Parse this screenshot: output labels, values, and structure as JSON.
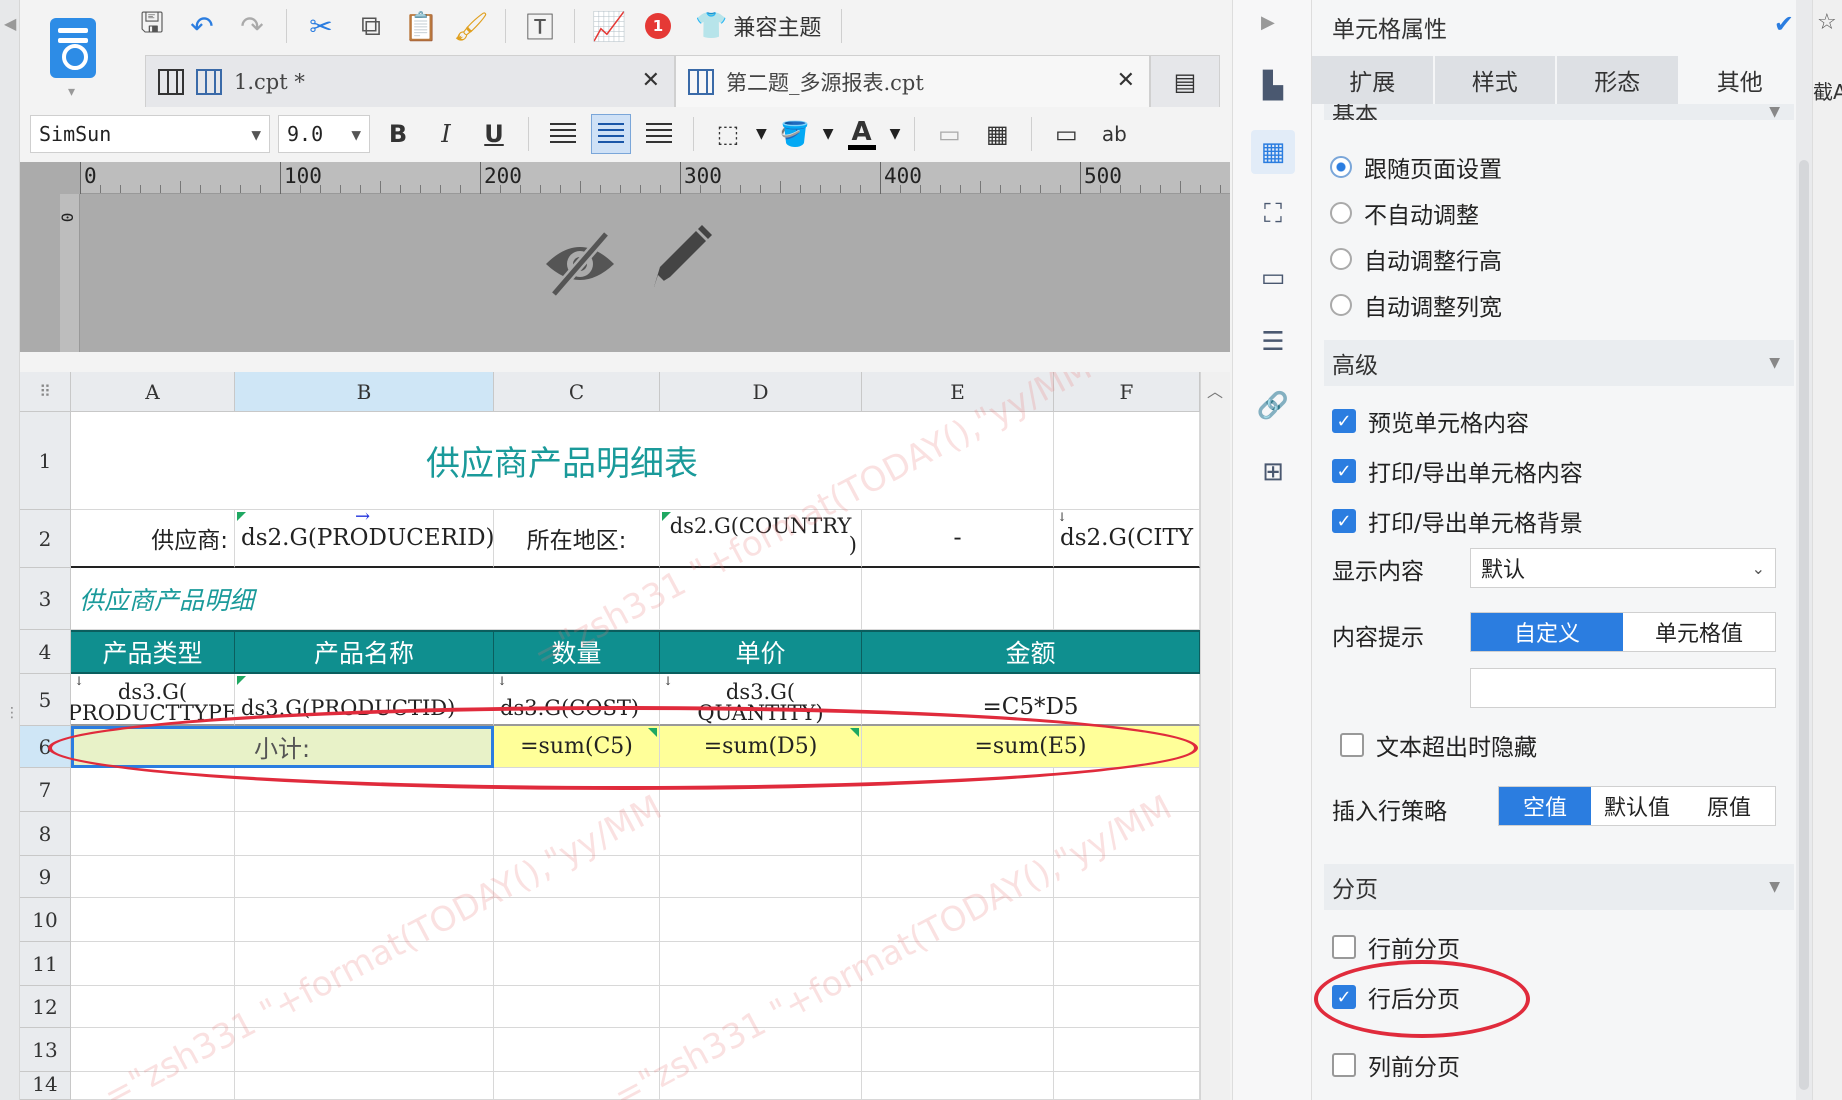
{
  "toolbar": {
    "compat_theme": "兼容主题",
    "notification_count": "1",
    "font_name": "SimSun",
    "font_size": "9.0",
    "bold": "B",
    "italic": "I",
    "underline": "U",
    "wrap_text": "ab",
    "font_color_label": "A"
  },
  "doc_tabs": [
    {
      "label": "1.cpt *",
      "active": false
    },
    {
      "label": "第二题_多源报表.cpt",
      "active": true
    }
  ],
  "ruler": {
    "labels": [
      "0",
      "100",
      "200",
      "300",
      "400",
      "500"
    ],
    "left_label": "0"
  },
  "grid": {
    "columns": [
      "A",
      "B",
      "C",
      "D",
      "E",
      "F"
    ],
    "rows": [
      "1",
      "2",
      "3",
      "4",
      "5",
      "6",
      "7",
      "8",
      "9",
      "10",
      "11",
      "12",
      "13",
      "14"
    ],
    "cells": {
      "title": "供应商产品明细表",
      "a2": "供应商:",
      "b2": "ds2.G(PRODUCERID)",
      "c2": "所在地区:",
      "d2": "ds2.G(COUNTRY",
      "d2b": ")",
      "e2": "-",
      "f2": "ds2.G(CITY",
      "a3": "供应商产品明细",
      "h_a": "产品类型",
      "h_b": "产品名称",
      "h_c": "数量",
      "h_d": "单价",
      "h_e": "金额",
      "a5": "ds3.G(",
      "a5b": "PRODUCTTYPE",
      "b5": "ds3.G(PRODUCTID)",
      "c5": "ds3.G(COST)",
      "d5": "ds3.G(",
      "d5b": "QUANTITY)",
      "e5": "=C5*D5",
      "a6": "小计:",
      "c6": "=sum(C5)",
      "d6": "=sum(D5)",
      "e6": "=sum(E5)"
    },
    "watermark": "=\"zsh331 \"+format(TODAY(),\"yy/MM"
  },
  "panel": {
    "title": "单元格属性",
    "tabs": [
      "扩展",
      "样式",
      "形态",
      "其他"
    ],
    "active_tab": "其他",
    "section_basic": "基本",
    "radios": [
      {
        "label": "跟随页面设置",
        "checked": true
      },
      {
        "label": "不自动调整",
        "checked": false
      },
      {
        "label": "自动调整行高",
        "checked": false
      },
      {
        "label": "自动调整列宽",
        "checked": false
      }
    ],
    "section_advanced": "高级",
    "adv_checks": [
      {
        "label": "预览单元格内容",
        "checked": true
      },
      {
        "label": "打印/导出单元格内容",
        "checked": true
      },
      {
        "label": "打印/导出单元格背景",
        "checked": true
      }
    ],
    "display_label": "显示内容",
    "display_value": "默认",
    "tooltip_label": "内容提示",
    "tooltip_opts": [
      "自定义",
      "单元格值"
    ],
    "hide_overflow": "文本超出时隐藏",
    "insert_label": "插入行策略",
    "insert_opts": [
      "空值",
      "默认值",
      "原值"
    ],
    "section_paging": "分页",
    "paging": [
      {
        "label": "行前分页",
        "checked": false
      },
      {
        "label": "行后分页",
        "checked": true
      },
      {
        "label": "列前分页",
        "checked": false
      }
    ]
  },
  "far_right_text": "截A",
  "colors": {
    "accent": "#2b7de0",
    "header_teal": "#0f8f8f",
    "title_teal": "#1a9a9a",
    "highlight_yellow": "#ffff99",
    "annotation_red": "#e02b3c"
  }
}
